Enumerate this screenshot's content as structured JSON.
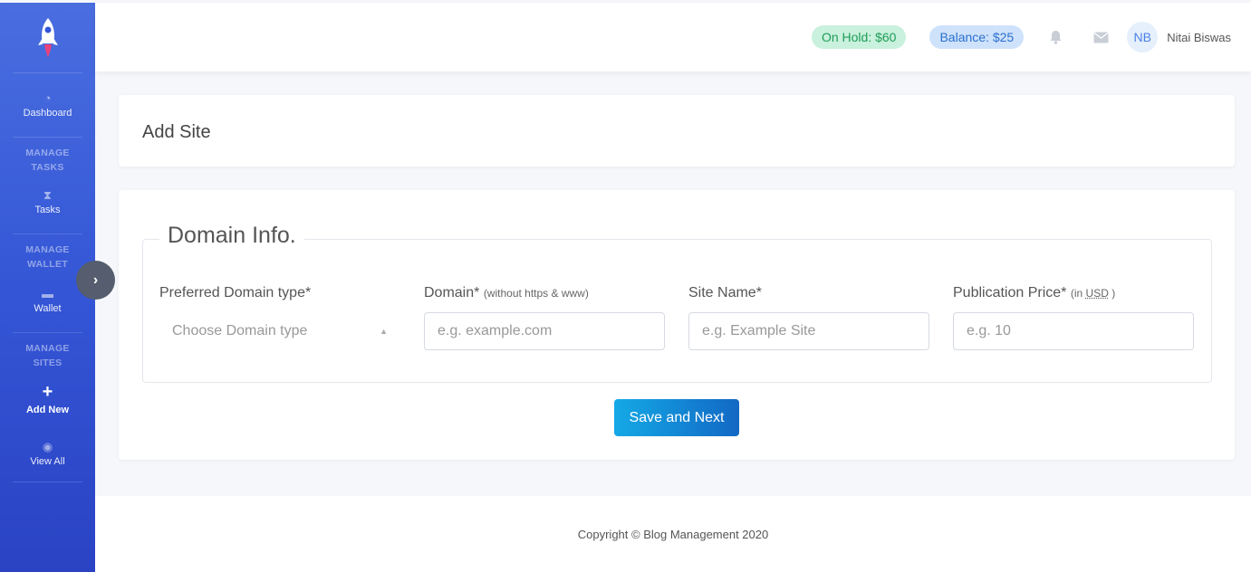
{
  "sidebar": {
    "logo": "rocket-icon",
    "items": {
      "dashboard": {
        "label": "Dashboard",
        "icon": "speedometer-icon"
      },
      "manage_tasks_heading": "MANAGE TASKS",
      "tasks": {
        "label": "Tasks",
        "icon": "hourglass-icon"
      },
      "manage_wallet_heading": "MANAGE WALLET",
      "wallet": {
        "label": "Wallet",
        "icon": "wallet-icon"
      },
      "manage_sites_heading": "MANAGE SITES",
      "add_new": {
        "label": "Add New",
        "icon": "plus-icon"
      },
      "view_all": {
        "label": "View All",
        "icon": "eye-icon"
      }
    },
    "toggle_icon": "chevron-right-icon"
  },
  "topbar": {
    "on_hold": "On Hold: $60",
    "balance": "Balance: $25",
    "bell_icon": "bell-icon",
    "mail_icon": "envelope-icon",
    "avatar_initials": "NB",
    "user_name": "Nitai Biswas"
  },
  "page": {
    "title": "Add Site"
  },
  "form": {
    "legend": "Domain Info.",
    "domain_type": {
      "label": "Preferred Domain type*",
      "placeholder": "Choose Domain type"
    },
    "domain": {
      "label": "Domain*",
      "hint": "(without https & www)",
      "placeholder": "e.g. example.com"
    },
    "site_name": {
      "label": "Site Name*",
      "placeholder": "e.g. Example Site"
    },
    "price": {
      "label": "Publication Price*",
      "hint_prefix": "(in ",
      "hint_unit": "USD",
      "hint_suffix": " )",
      "placeholder": "e.g. 10"
    },
    "submit_label": "Save and Next"
  },
  "footer": {
    "copyright": "Copyright © Blog Management 2020"
  },
  "colors": {
    "sidebar_top": "#4a6ee0",
    "sidebar_bottom": "#2a43c4",
    "hold_bg": "#c9f1dd",
    "hold_text": "#1f9d57",
    "balance_bg": "#cfe2fb",
    "balance_text": "#2a6fce",
    "button_start": "#14a9e6",
    "button_end": "#1268c4"
  }
}
